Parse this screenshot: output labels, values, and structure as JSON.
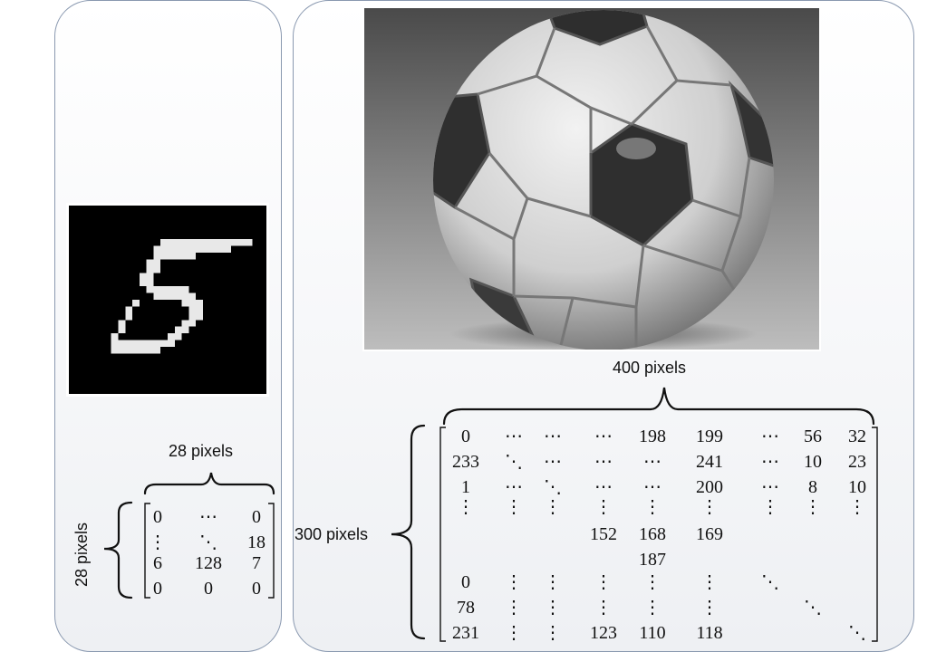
{
  "labels": {
    "small_width": "28 pixels",
    "small_height": "28 pixels",
    "big_width": "400 pixels",
    "big_height": "300 pixels"
  },
  "images": {
    "left": "handwritten-digit-5",
    "right": "soccer-ball-grayscale"
  },
  "small_matrix": [
    [
      "0",
      "⋯",
      "0"
    ],
    [
      "⋮",
      "⋱",
      "18"
    ],
    [
      "6",
      "128",
      "7"
    ],
    [
      "0",
      "0",
      "0"
    ]
  ],
  "big_matrix": [
    [
      "0",
      "⋯",
      "⋯",
      "⋯",
      "198",
      "199",
      "⋯",
      "56",
      "32"
    ],
    [
      "233",
      "⋱",
      "⋯",
      "⋯",
      "⋯",
      "241",
      "⋯",
      "10",
      "23"
    ],
    [
      "1",
      "⋯",
      "⋱",
      "⋯",
      "⋯",
      "200",
      "⋯",
      "8",
      "10"
    ],
    [
      "⋮",
      "⋮",
      "⋮",
      "⋮",
      "⋮",
      "⋮",
      "⋮",
      "⋮",
      "⋮"
    ],
    [
      "",
      "",
      "",
      "152",
      "168",
      "169",
      "",
      "",
      ""
    ],
    [
      "",
      "",
      "",
      "",
      "187",
      "",
      "",
      "",
      ""
    ],
    [
      "0",
      "⋮",
      "⋮",
      "⋮",
      "⋮",
      "⋮",
      "⋱",
      "",
      ""
    ],
    [
      "78",
      "⋮",
      "⋮",
      "⋮",
      "⋮",
      "⋮",
      "",
      "⋱",
      ""
    ],
    [
      "231",
      "⋮",
      "⋮",
      "123",
      "110",
      "118",
      "",
      "",
      "⋱"
    ]
  ]
}
